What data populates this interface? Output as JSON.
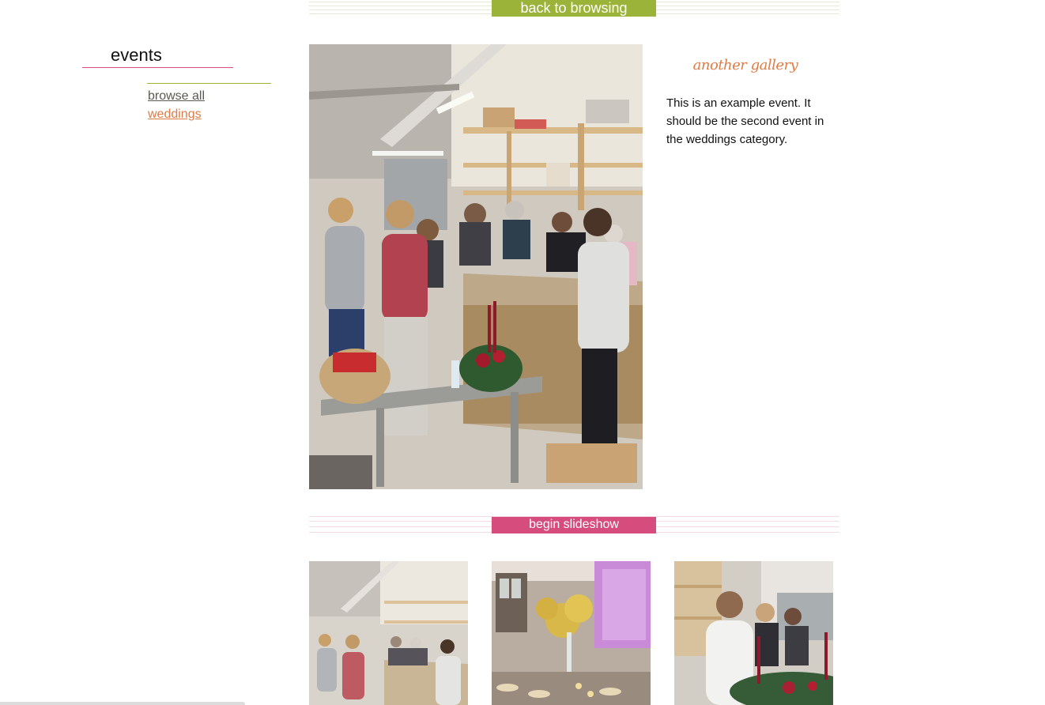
{
  "nav": {
    "back_label": "back to browsing",
    "slideshow_label": "begin slideshow"
  },
  "sidebar": {
    "title": "events",
    "links": [
      {
        "label": "browse all"
      },
      {
        "label": "weddings"
      }
    ]
  },
  "gallery": {
    "title": "another gallery",
    "description": "This is an example event. It should be the second event in the weddings category."
  },
  "colors": {
    "accent_green": "#9cb33a",
    "accent_pink": "#d64d7d",
    "accent_orange": "#e07b45"
  },
  "thumbnails": [
    {
      "subject": "workshop-group"
    },
    {
      "subject": "table-centerpiece"
    },
    {
      "subject": "woman-arranging-wreath"
    }
  ]
}
